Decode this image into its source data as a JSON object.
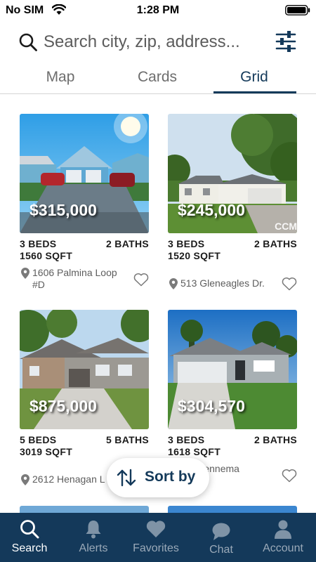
{
  "status_bar": {
    "carrier": "No SIM",
    "time": "1:28 PM"
  },
  "search": {
    "placeholder": "Search city, zip, address..."
  },
  "tabs": [
    {
      "label": "Map"
    },
    {
      "label": "Cards"
    },
    {
      "label": "Grid",
      "active": true
    }
  ],
  "listings": [
    {
      "price": "$315,000",
      "beds": "3 BEDS",
      "baths": "2 BATHS",
      "sqft": "1560 SQFT",
      "address": "1606 Palmina Loop #D"
    },
    {
      "price": "$245,000",
      "beds": "3 BEDS",
      "baths": "2 BATHS",
      "sqft": "1520 SQFT",
      "address": "513 Gleneagles Dr.",
      "watermark": "CCM"
    },
    {
      "price": "$875,000",
      "beds": "5 BEDS",
      "baths": "5 BATHS",
      "sqft": "3019 SQFT",
      "address": "2612 Henagan L"
    },
    {
      "price": "$304,570",
      "beds": "3 BEDS",
      "baths": "2 BATHS",
      "sqft": "1618 SQFT",
      "address": "Sennema"
    }
  ],
  "sort": {
    "label": "Sort by",
    "icon": "sort-arrows-icon"
  },
  "nav": [
    {
      "label": "Search",
      "icon": "search-icon",
      "active": true
    },
    {
      "label": "Alerts",
      "icon": "bell-icon"
    },
    {
      "label": "Favorites",
      "icon": "heart-icon"
    },
    {
      "label": "Chat",
      "icon": "chat-icon"
    },
    {
      "label": "Account",
      "icon": "user-icon"
    }
  ],
  "colors": {
    "brand": "#14395a",
    "tab_active": "#143a5a",
    "nav_inactive": "#9aa9b8"
  }
}
